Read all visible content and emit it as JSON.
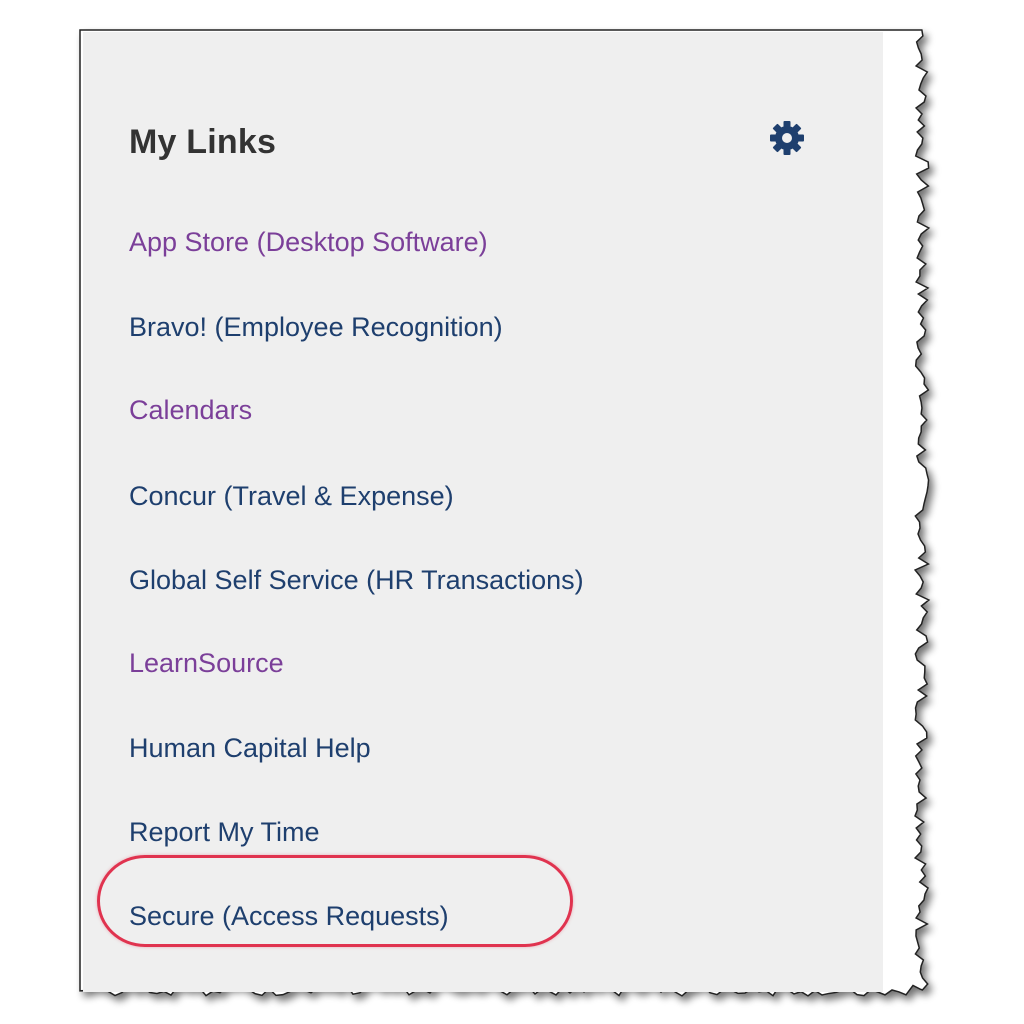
{
  "panel": {
    "title": "My Links",
    "settings_icon": "gear-icon",
    "background_color": "#efefef",
    "title_color": "#333333",
    "gear_color": "#1e3f6e"
  },
  "links": [
    {
      "label": "App Store (Desktop Software)",
      "visited": true
    },
    {
      "label": "Bravo! (Employee Recognition)",
      "visited": false
    },
    {
      "label": "Calendars",
      "visited": true
    },
    {
      "label": "Concur (Travel & Expense)",
      "visited": false
    },
    {
      "label": "Global Self Service (HR Transactions)",
      "visited": false
    },
    {
      "label": "LearnSource",
      "visited": true
    },
    {
      "label": "Human Capital Help",
      "visited": false
    },
    {
      "label": "Report My Time",
      "visited": false
    },
    {
      "label": "Secure (Access Requests)",
      "visited": false,
      "highlighted": true
    }
  ],
  "colors": {
    "visited_link": "#7b3f99",
    "link": "#1e3f6e",
    "highlight_ring": "#e0334f"
  }
}
